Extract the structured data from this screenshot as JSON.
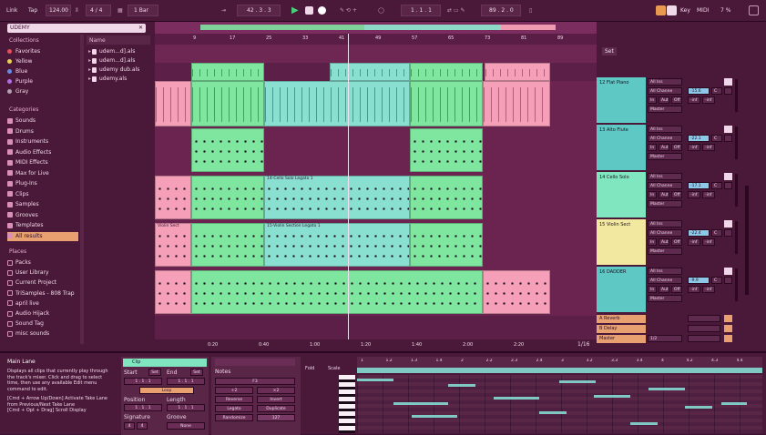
{
  "transport": {
    "link": "Link",
    "tap": "Tap",
    "tempo": "124.00",
    "signature": "4 / 4",
    "quantize": "1 Bar",
    "position": "42 . 3 . 3",
    "loop_start": "1 . 1 . 1",
    "loop_length": "89 . 2 . 0",
    "key_label": "Key",
    "midi_label": "MIDI",
    "cpu": "7 %"
  },
  "browser": {
    "search": "UDEMY",
    "collections_title": "Collections",
    "collections": [
      {
        "label": "Favorites",
        "color": "#e0505a"
      },
      {
        "label": "Yellow",
        "color": "#e6d05a"
      },
      {
        "label": "Blue",
        "color": "#6a8ae0"
      },
      {
        "label": "Purple",
        "color": "#b070e0"
      },
      {
        "label": "Gray",
        "color": "#b0a0b0"
      }
    ],
    "categories_title": "Categories",
    "categories": [
      "Sounds",
      "Drums",
      "Instruments",
      "Audio Effects",
      "MIDI Effects",
      "Max for Live",
      "Plug-Ins",
      "Clips",
      "Samples",
      "Grooves",
      "Templates",
      "All results"
    ],
    "places_title": "Places",
    "places": [
      "Packs",
      "User Library",
      "Current Project",
      "TriSamples - 808 Trap",
      "april live",
      "Audio Hijack",
      "Sound Tag",
      "misc sounds"
    ],
    "files_header": "Name",
    "files": [
      "udem...d].als",
      "udem...d].als",
      "udemy dub.als",
      "udemy.als"
    ]
  },
  "arrangement": {
    "bar_numbers": [
      "9",
      "17",
      "25",
      "33",
      "41",
      "49",
      "57",
      "65",
      "73",
      "81",
      "89"
    ],
    "time_labels": [
      "0:20",
      "0:40",
      "1:00",
      "1:20",
      "1:40",
      "2:00",
      "2:20"
    ],
    "clip_labels": {
      "cello": "14-Cello Solo Legato 1",
      "violin_left": "Violin Sect",
      "violin": "15-Violin Section Legato 1"
    },
    "zoom": "1/16"
  },
  "mixer": {
    "set_label": "Set",
    "tracks": [
      {
        "name": "12 Flat Piano",
        "color": "#5ec8c4",
        "vol": "-15.6",
        "pan": "C"
      },
      {
        "name": "13 Alto Flute",
        "color": "#5ec8c4",
        "vol": "-22.1",
        "pan": "C"
      },
      {
        "name": "14 Cello Solo",
        "color": "#7fe6c0",
        "vol": "-17.1",
        "pan": "C"
      },
      {
        "name": "15 Violin Sect",
        "color": "#f2e8a0",
        "vol": "-22.4",
        "pan": "C"
      },
      {
        "name": "16 DADDER",
        "color": "#5ec8c4",
        "vol": "-9.9",
        "pan": "C"
      }
    ],
    "io": {
      "in": "All Ins",
      "channel": "All Channe",
      "monitor": "In",
      "auto": "Auto",
      "off": "Off",
      "out": "Master",
      "inf": "-inf"
    },
    "returns": [
      {
        "name": "A Reverb",
        "color": "#e8a070"
      },
      {
        "name": "B Delay",
        "color": "#e8a070"
      },
      {
        "name": "Master",
        "color": "#e8a070"
      }
    ],
    "master_sel": "1/2"
  },
  "info": {
    "title": "Main Lane",
    "body": "Displays all clips that currently play through the track's mixer. Click and drag to select time, then use any available Edit menu command to edit.",
    "hint1": "[Cmd + Arrow Up/Down] Activate Take Lane from Previous/Next Take Lane",
    "hint2": "[Cmd + Opt + Drag] Scroll Display"
  },
  "clip_panel": {
    "name": "Clip",
    "start": "Start",
    "end": "End",
    "set": "Set",
    "start_val": "1 . 1 . 1",
    "end_val": "1 . 1 . 1",
    "loop": "Loop",
    "position": "Position",
    "length": "Length",
    "signature": "Signature",
    "groove": "Groove",
    "sig_num": "4",
    "sig_den": "4",
    "groove_val": "None"
  },
  "notes_panel": {
    "title": "Notes",
    "key": "F3",
    "transpose_down": "÷2",
    "transpose_up": "×2",
    "reverse": "Reverse",
    "invert": "Invert",
    "legato": "Legato",
    "duplicate": "Duplicate",
    "randomize": "Randomize",
    "velocity": "127"
  },
  "piano_roll": {
    "fold": "Fold",
    "scale": "Scale",
    "ruler": [
      "1",
      "1.2",
      "1.3",
      "1.4",
      "2",
      "2.2",
      "2.3",
      "2.4",
      "3",
      "3.2",
      "3.3",
      "3.4",
      "4",
      "4.2",
      "4.3",
      "4.4"
    ]
  }
}
